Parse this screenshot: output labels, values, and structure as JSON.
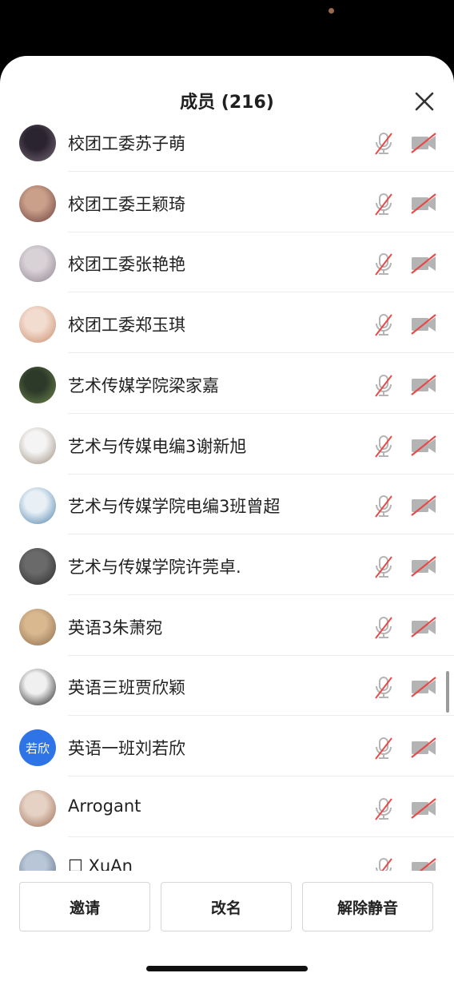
{
  "panel": {
    "title": "成员 (216)"
  },
  "members": [
    {
      "name": "校团工委苏子萌",
      "avatar": {
        "type": "photo",
        "colors": [
          "#2a2430",
          "#7a6a78"
        ]
      },
      "mic": "muted",
      "camera": "off"
    },
    {
      "name": "校团工委王颖琦",
      "avatar": {
        "type": "photo",
        "colors": [
          "#caa08a",
          "#6c3c3c"
        ]
      },
      "mic": "muted",
      "camera": "off"
    },
    {
      "name": "校团工委张艳艳",
      "avatar": {
        "type": "photo",
        "colors": [
          "#d8d2d6",
          "#8f8290"
        ]
      },
      "mic": "muted",
      "camera": "off"
    },
    {
      "name": "校团工委郑玉琪",
      "avatar": {
        "type": "photo",
        "colors": [
          "#f2dccf",
          "#c98a6a"
        ]
      },
      "mic": "muted",
      "camera": "off"
    },
    {
      "name": "艺术传媒学院梁家嘉",
      "avatar": {
        "type": "photo",
        "colors": [
          "#2d3a2a",
          "#6f8a4c"
        ]
      },
      "mic": "muted",
      "camera": "off"
    },
    {
      "name": "艺术与传媒电编3谢新旭",
      "avatar": {
        "type": "photo",
        "colors": [
          "#f4f4f4",
          "#9a8a78"
        ]
      },
      "mic": "muted",
      "camera": "off"
    },
    {
      "name": "艺术与传媒学院电编3班曾超",
      "avatar": {
        "type": "photo",
        "colors": [
          "#e8f0f6",
          "#4a7ea8"
        ]
      },
      "mic": "muted",
      "camera": "off"
    },
    {
      "name": "艺术与传媒学院许莞卓.",
      "avatar": {
        "type": "photo",
        "colors": [
          "#6a6a6a",
          "#2a2a2a"
        ]
      },
      "mic": "muted",
      "camera": "off"
    },
    {
      "name": "英语3朱萧宛",
      "avatar": {
        "type": "photo",
        "colors": [
          "#d9b890",
          "#8a6b4a"
        ]
      },
      "mic": "muted",
      "camera": "off"
    },
    {
      "name": "英语三班贾欣颖",
      "avatar": {
        "type": "photo",
        "colors": [
          "#f0f0f0",
          "#1a1a1a"
        ]
      },
      "mic": "muted",
      "camera": "off"
    },
    {
      "name": "英语一班刘若欣",
      "avatar": {
        "type": "text",
        "text": "若欣",
        "colors": [
          "#2f74e6",
          "#2f74e6"
        ]
      },
      "mic": "muted",
      "camera": "off"
    },
    {
      "name": "Arrogant",
      "avatar": {
        "type": "photo",
        "colors": [
          "#e6d2c4",
          "#9a6a52"
        ]
      },
      "mic": "muted",
      "camera": "off"
    },
    {
      "name": "☐ XuAn",
      "avatar": {
        "type": "photo",
        "colors": [
          "#b8c6d8",
          "#5a6a80"
        ]
      },
      "mic": "muted",
      "camera": "off"
    }
  ],
  "footer": {
    "invite_label": "邀请",
    "rename_label": "改名",
    "unmute_label": "解除静音"
  },
  "colors": {
    "muted_slash": "#e64a4a",
    "icon_gray": "#b4b4b4",
    "text_avatar_blue": "#2f74e6"
  }
}
